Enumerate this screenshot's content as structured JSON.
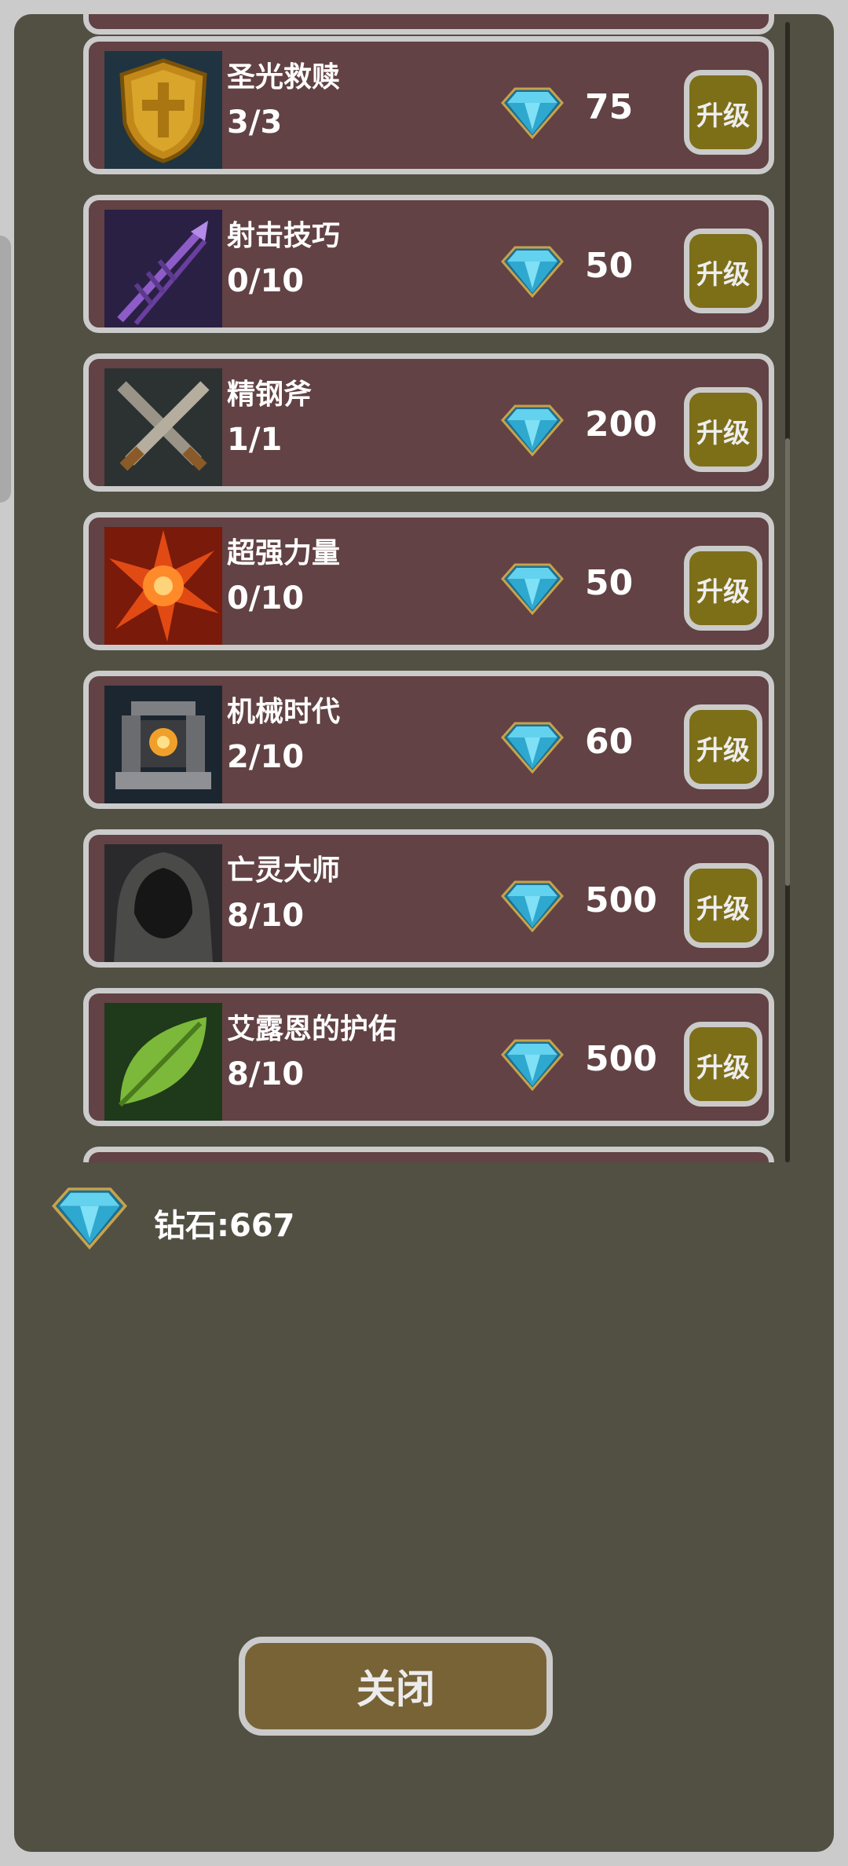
{
  "items": [
    {
      "name": "圣光救赎",
      "level": "3/3",
      "cost": "75",
      "button": "升级",
      "icon": "golden-shield-icon"
    },
    {
      "name": "射击技巧",
      "level": "0/10",
      "cost": "50",
      "button": "升级",
      "icon": "purple-arrow-icon"
    },
    {
      "name": "精钢斧",
      "level": "1/1",
      "cost": "200",
      "button": "升级",
      "icon": "crossed-blades-icon"
    },
    {
      "name": "超强力量",
      "level": "0/10",
      "cost": "50",
      "button": "升级",
      "icon": "fire-burst-icon"
    },
    {
      "name": "机械时代",
      "level": "2/10",
      "cost": "60",
      "button": "升级",
      "icon": "forge-machine-icon"
    },
    {
      "name": "亡灵大师",
      "level": "8/10",
      "cost": "500",
      "button": "升级",
      "icon": "hooded-figure-icon"
    },
    {
      "name": "艾露恩的护佑",
      "level": "8/10",
      "cost": "500",
      "button": "升级",
      "icon": "green-leaf-icon"
    }
  ],
  "footer": {
    "diamond_label": "钻石:667",
    "currency_icon": "diamond-icon"
  },
  "close_label": "关闭",
  "colors": {
    "panel_bg": "#525043",
    "panel_border": "#cbcbcb",
    "item_bg": "#624244",
    "upgrade_btn": "#7d6e18",
    "close_btn": "#786337",
    "gem": "#35b6d6"
  }
}
